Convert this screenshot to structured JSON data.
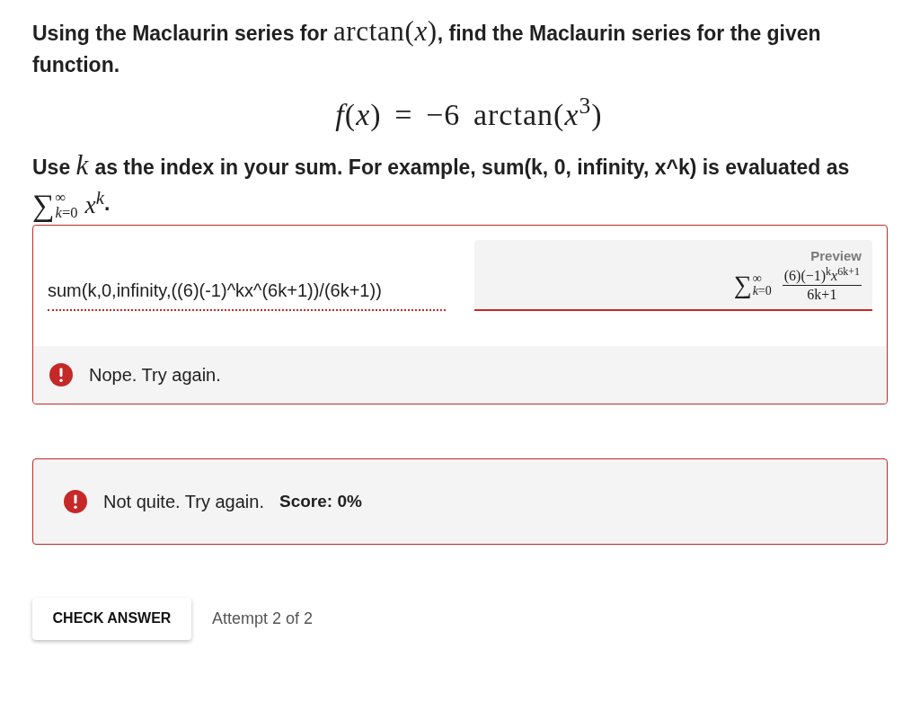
{
  "question": {
    "intro": [
      {
        "kind": "text",
        "text": "Using the Maclaurin series for "
      },
      {
        "kind": "math",
        "text": "arctan(*x*)"
      },
      {
        "kind": "text",
        "text": ", find the Maclaurin series for the given function."
      }
    ],
    "equation": "*f*(*x*) = −6 arctan(*x*$^{3}$)",
    "instructions": [
      {
        "kind": "text",
        "text": "Use "
      },
      {
        "kind": "math",
        "text": "*k*"
      },
      {
        "kind": "text",
        "text": " as the index in your sum. For example, sum(k, 0, infinity, x^k) is evaluated as "
      },
      {
        "kind": "sum",
        "symbol": "∑",
        "upper": "∞",
        "lower": "*k*=0",
        "body": "*x*$^{k}$"
      },
      {
        "kind": "text",
        "text": "."
      }
    ]
  },
  "answer": {
    "value": "sum(k,0,infinity,((6)(-1)^kx^(6k+1))/(6k+1))",
    "error": true,
    "preview": {
      "label": "Preview",
      "symbol": "∑",
      "upper": "∞",
      "lower": "*k*=0",
      "numerator": "(6)(−1)$^{k}$*x*$^{6k+1}$",
      "denominator": "6k+1"
    },
    "feedback": {
      "correct": false,
      "message": "Nope. Try again."
    }
  },
  "result": {
    "correct": false,
    "message": "Not quite. Try again.",
    "score": "Score: 0%"
  },
  "actions": {
    "button": "CHECK ANSWER",
    "attempt": "Attempt 2 of 2"
  }
}
